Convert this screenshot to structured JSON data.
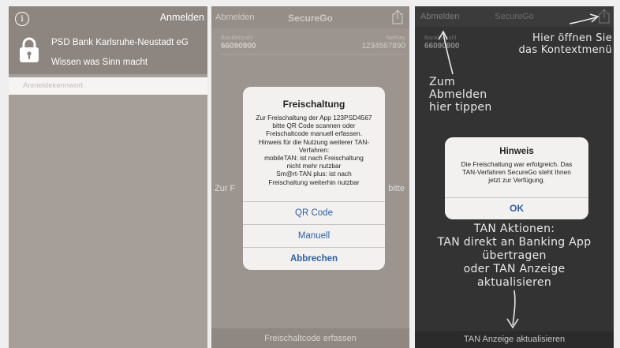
{
  "screen1": {
    "anmelden_label": "Anmelden",
    "info_icon": "i",
    "bank_name": "PSD Bank Karlsruhe-Neustadt eG",
    "slogan": "Wissen was Sinn macht",
    "password_placeholder": "Anmeldekennwort"
  },
  "screen2": {
    "abmelden_label": "Abmelden",
    "title": "SecureGo",
    "bankleitzahl_label": "Bankleitzahl",
    "bankleitzahl_value": "66090900",
    "netkey_label": "NetKey",
    "netkey_value": "1234567890",
    "background_text_left": "Zur F",
    "background_text_right": "bitte",
    "bottom_button": "Freischaltcode erfassen",
    "dialog": {
      "title": "Freischaltung",
      "body_lines": [
        "Zur Freischaltung der App 123PSD4567",
        "bitte QR Code scannen oder",
        "Freischaltcode manuell erfassen.",
        "Hinweis für die Nutzung weiterer TAN-",
        "Verfahren:",
        "mobileTAN: ist nach Freischaltung",
        "nicht mehr nutzbar",
        "Sm@rt-TAN plus: ist nach",
        "Freischaltung weiterhin nutzbar"
      ],
      "buttons": [
        "QR Code",
        "Manuell",
        "Abbrechen"
      ]
    }
  },
  "screen3": {
    "abmelden_label": "Abmelden",
    "title": "SecureGo",
    "bankleitzahl_label": "Bankleitzahl",
    "bankleitzahl_value": "66090900",
    "annotation_context_menu": [
      "Hier öffnen Sie",
      "das Kontextmenü"
    ],
    "annotation_logout": [
      "Zum",
      "Abmelden",
      "hier tippen"
    ],
    "annotation_tan": [
      "TAN Aktionen:",
      "TAN direkt an Banking App",
      "übertragen",
      "oder TAN Anzeige",
      "aktualisieren"
    ],
    "bottom_button": "TAN Anzeige aktualisieren",
    "dialog": {
      "title": "Hinweis",
      "body_lines": [
        "Die Freischaltung war erfolgreich. Das",
        "TAN-Verfahren SecureGo steht Ihnen",
        "jetzt zur Verfügung."
      ],
      "ok_label": "OK"
    }
  }
}
